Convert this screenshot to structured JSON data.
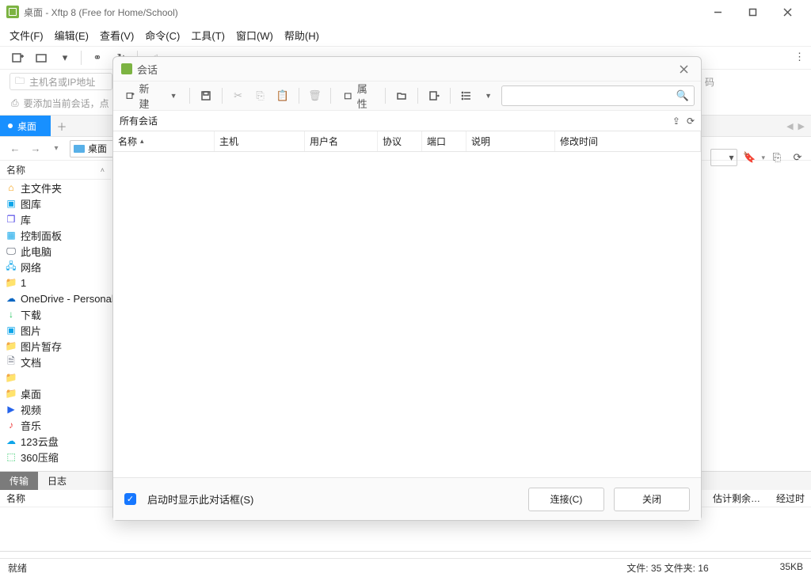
{
  "window": {
    "title": "桌面 - Xftp 8 (Free for Home/School)"
  },
  "menu": {
    "file": "文件(F)",
    "edit": "编辑(E)",
    "view": "查看(V)",
    "cmd": "命令(C)",
    "tool": "工具(T)",
    "window": "窗口(W)",
    "help": "帮助(H)"
  },
  "addr": {
    "placeholder": "主机名或IP地址"
  },
  "hint": "要添加当前会话，点",
  "password_hint": "码",
  "tab": {
    "label": "桌面"
  },
  "nav": {
    "location": "桌面"
  },
  "tree": {
    "header": "名称",
    "items": [
      {
        "label": "主文件夹",
        "icon": "ic-home",
        "glyph": "⌂"
      },
      {
        "label": "图库",
        "icon": "ic-pic",
        "glyph": "▣"
      },
      {
        "label": "库",
        "icon": "ic-lib",
        "glyph": "❒"
      },
      {
        "label": "控制面板",
        "icon": "ic-cp",
        "glyph": "▦"
      },
      {
        "label": "此电脑",
        "icon": "ic-pc",
        "glyph": "🖵"
      },
      {
        "label": "网络",
        "icon": "ic-net",
        "glyph": "🖧"
      },
      {
        "label": "1",
        "icon": "ic-folder",
        "glyph": "📁"
      },
      {
        "label": "OneDrive - Personal",
        "icon": "ic-od",
        "glyph": "☁"
      },
      {
        "label": "下载",
        "icon": "ic-dl",
        "glyph": "↓"
      },
      {
        "label": "图片",
        "icon": "ic-pic",
        "glyph": "▣"
      },
      {
        "label": "图片暂存",
        "icon": "ic-folder",
        "glyph": "📁"
      },
      {
        "label": "文档",
        "icon": "ic-doc",
        "glyph": "🗎"
      },
      {
        "label": "",
        "icon": "ic-folder",
        "glyph": "📁"
      },
      {
        "label": "桌面",
        "icon": "ic-folder",
        "glyph": "📁"
      },
      {
        "label": "视频",
        "icon": "ic-vid",
        "glyph": "▶"
      },
      {
        "label": "音乐",
        "icon": "ic-mus",
        "glyph": "♪"
      },
      {
        "label": "123云盘",
        "icon": "ic-yun",
        "glyph": "☁"
      },
      {
        "label": "360压缩",
        "icon": "ic-zip",
        "glyph": "⬚"
      }
    ]
  },
  "bottom_tabs": {
    "transfer": "传输",
    "log": "日志"
  },
  "transfer": {
    "name": "名称",
    "est": "估计剩余…",
    "elapsed": "经过时"
  },
  "status": {
    "ready": "就绪",
    "files": "文件: 35  文件夹: 16",
    "size": "35KB"
  },
  "dialog": {
    "title": "会话",
    "new": "新建",
    "props": "属性",
    "crumb": "所有会话",
    "cols": {
      "name": "名称",
      "host": "主机",
      "user": "用户名",
      "proto": "协议",
      "port": "端口",
      "desc": "说明",
      "time": "修改时间"
    },
    "show_on_start": "启动时显示此对话框(S)",
    "connect": "连接(C)",
    "close": "关闭"
  }
}
